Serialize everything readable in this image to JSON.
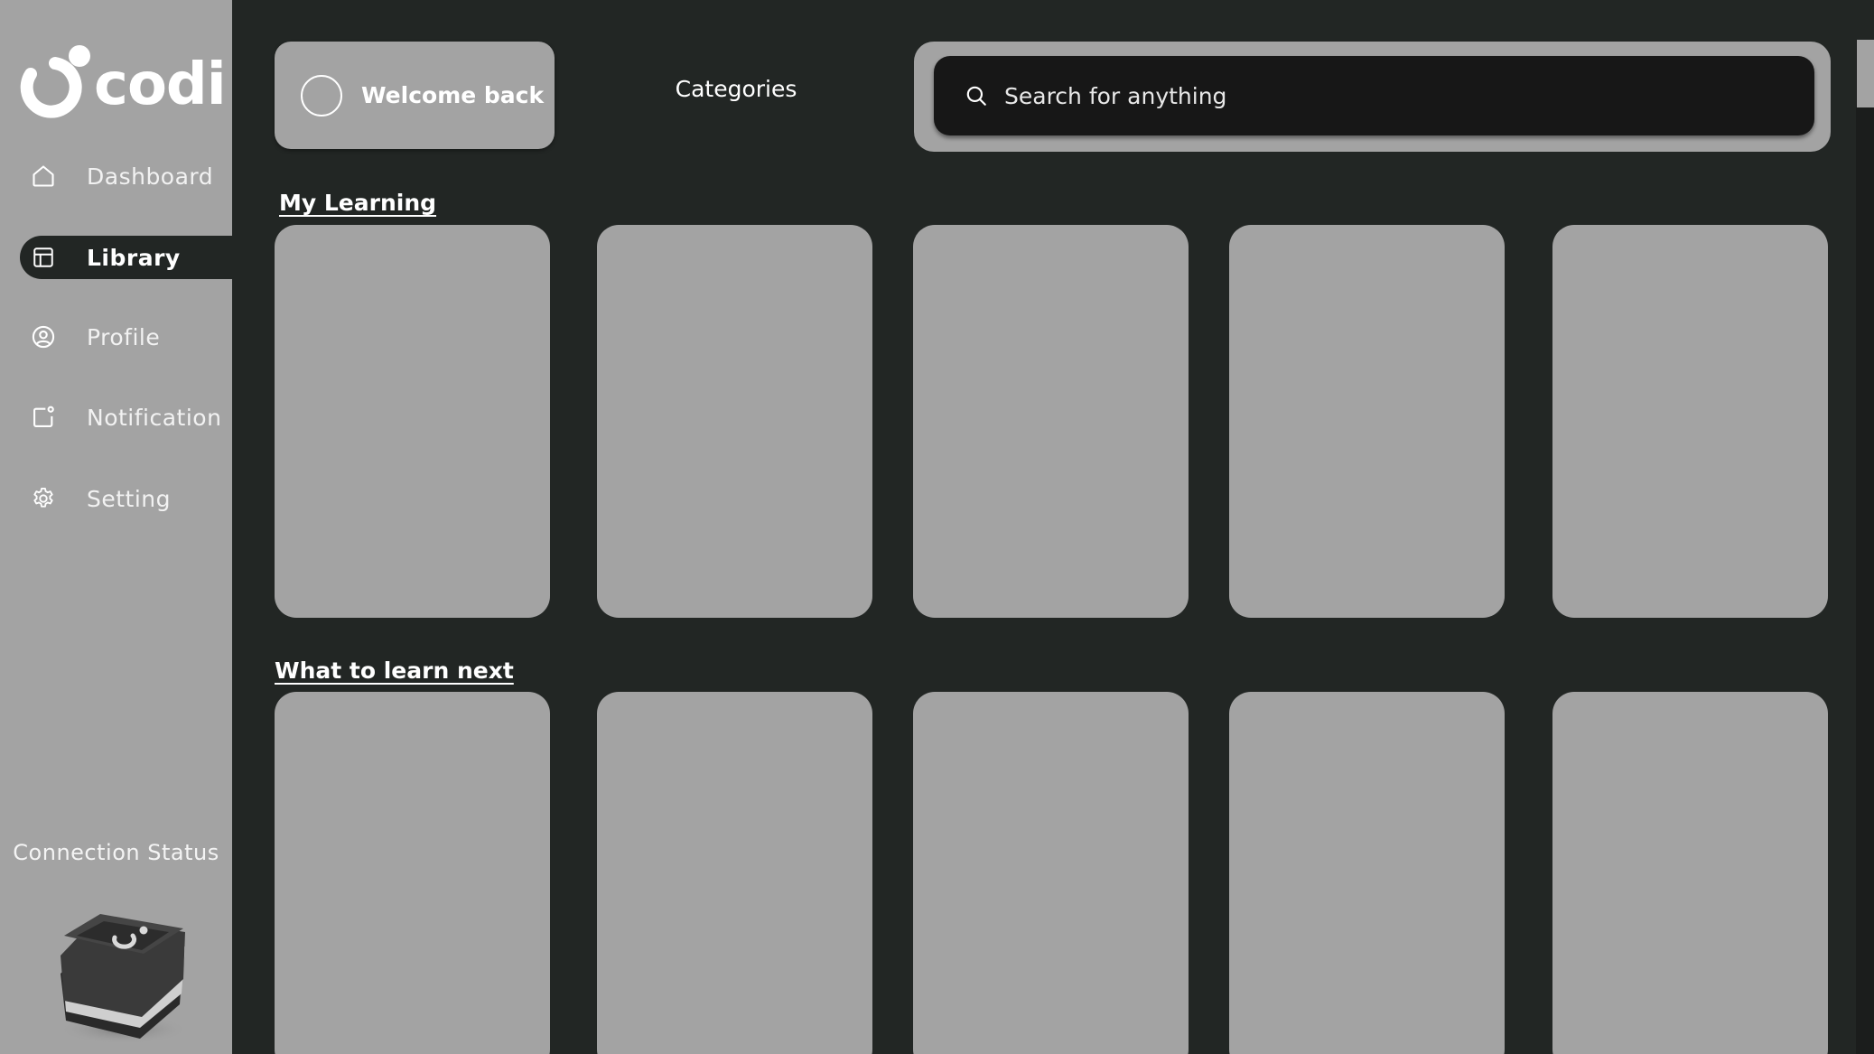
{
  "sidebar": {
    "logo_text": "codi",
    "items": [
      {
        "label": "Dashboard",
        "icon": "home-icon"
      },
      {
        "label": "Library",
        "icon": "library-icon",
        "active": true
      },
      {
        "label": "Profile",
        "icon": "user-circle-icon"
      },
      {
        "label": "Notification",
        "icon": "notification-icon"
      },
      {
        "label": "Setting",
        "icon": "gear-icon"
      }
    ],
    "connection_status_label": "Connection Status"
  },
  "header": {
    "welcome_text": "Welcome back",
    "categories_label": "Categories",
    "search_placeholder": "Search for anything"
  },
  "sections": [
    {
      "title": "My Learning",
      "card_count": 5
    },
    {
      "title": "What to learn next",
      "card_count": 5
    }
  ],
  "colors": {
    "background": "#222624",
    "panel": "#a3a3a3",
    "search_field": "#171717",
    "text": "#ffffff"
  }
}
